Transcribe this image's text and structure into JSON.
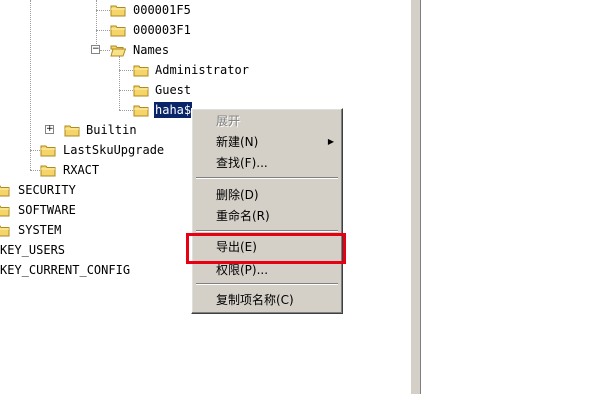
{
  "tree": {
    "n1": "000001F5",
    "n2": "000003F1",
    "names": "Names",
    "administrator": "Administrator",
    "guest": "Guest",
    "haha": "haha$",
    "builtin": "Builtin",
    "lastsku": "LastSkuUpgrade",
    "rxact": "RXACT",
    "security": "SECURITY",
    "software": "SOFTWARE",
    "system": "SYSTEM",
    "hkey_users": "KEY_USERS",
    "hkey_current_config": "KEY_CURRENT_CONFIG"
  },
  "tree_expanders": {
    "names": "−",
    "builtin": "+"
  },
  "context_menu": {
    "expand": "展开",
    "new": "新建(N)",
    "new_arrow": "▶",
    "find": "查找(F)...",
    "delete": "删除(D)",
    "rename": "重命名(R)",
    "export": "导出(E)",
    "permissions": "权限(P)...",
    "copy_key_name": "复制项名称(C)"
  },
  "colors": {
    "selection": "#0a246a",
    "menu_bg": "#d4d0c8",
    "highlight_box": "#e60012",
    "folder": "#f5d46a"
  }
}
